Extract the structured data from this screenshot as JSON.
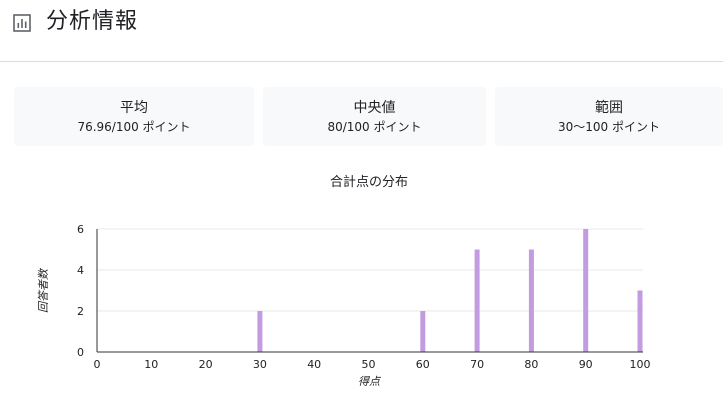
{
  "header": {
    "title": "分析情報",
    "icon": "bar-chart-icon"
  },
  "stats": {
    "average": {
      "label": "平均",
      "value": "76.96/100 ポイント"
    },
    "median": {
      "label": "中央値",
      "value": "80/100 ポイント"
    },
    "range": {
      "label": "範囲",
      "value": "30〜100 ポイント"
    }
  },
  "chart_data": {
    "type": "bar",
    "title": "合計点の分布",
    "xlabel": "得点",
    "ylabel": "回答者数",
    "x": [
      30,
      60,
      70,
      80,
      90,
      100
    ],
    "values": [
      2,
      2,
      5,
      5,
      6,
      3
    ],
    "xlim": [
      0,
      100
    ],
    "ylim": [
      0,
      6
    ],
    "x_ticks": [
      "0",
      "10",
      "20",
      "30",
      "40",
      "50",
      "60",
      "70",
      "80",
      "90",
      "100"
    ],
    "y_ticks": [
      "0",
      "2",
      "4",
      "6"
    ],
    "grid": true,
    "bar_color": "#c39be0"
  }
}
